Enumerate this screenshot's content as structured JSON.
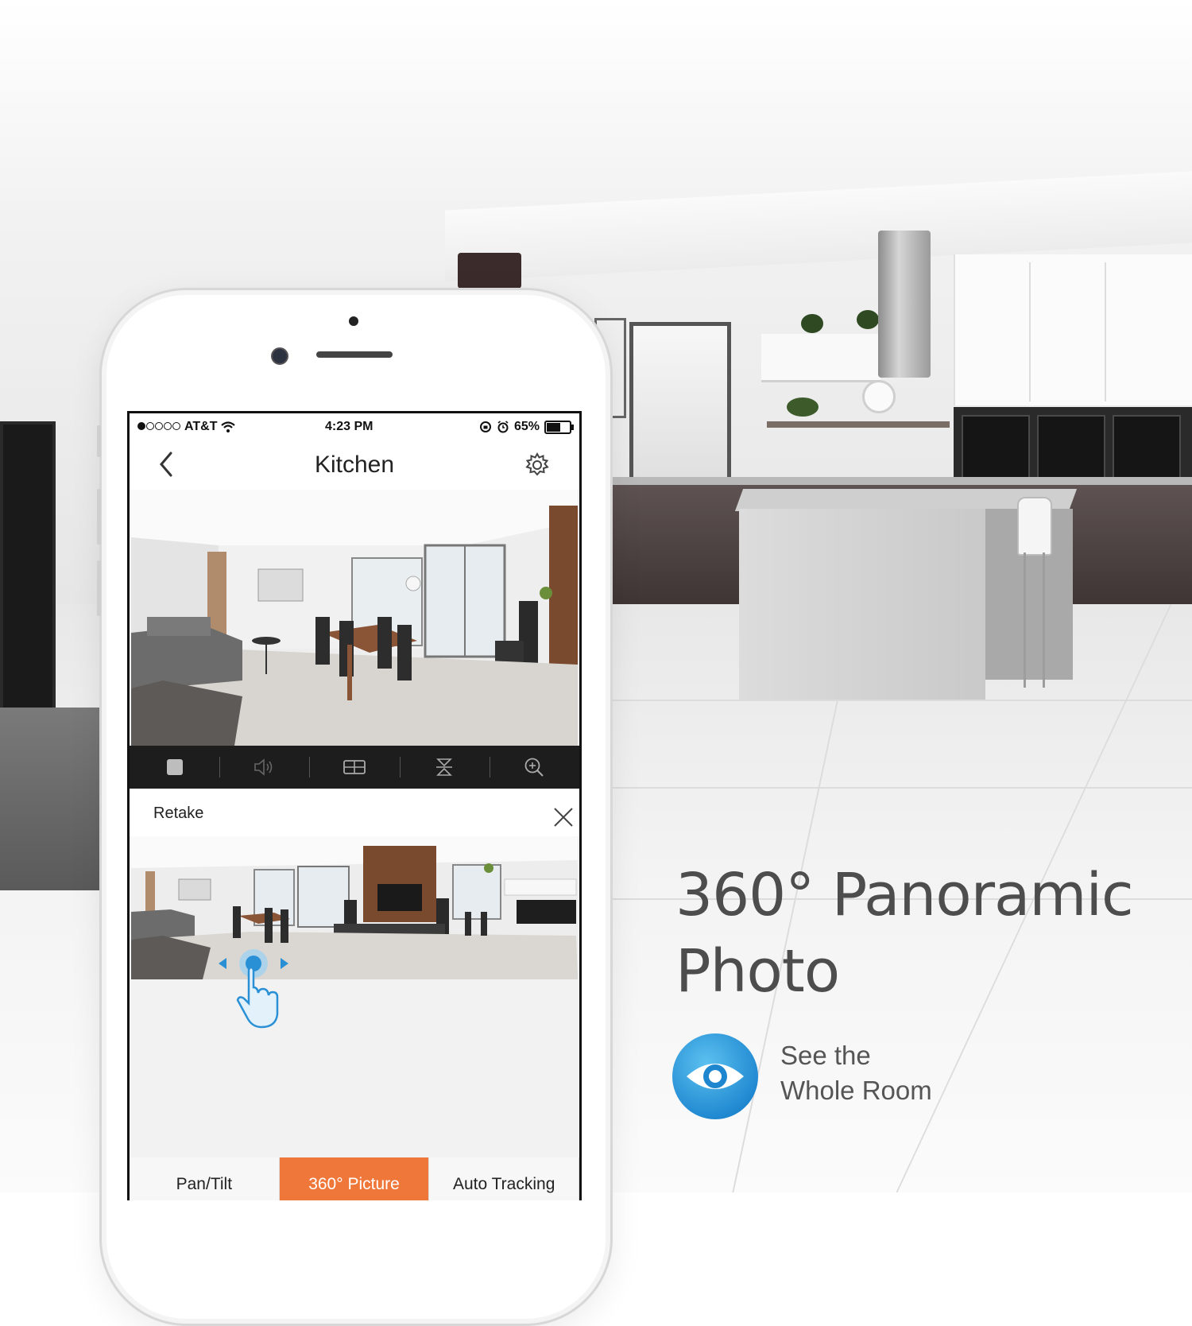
{
  "status_bar": {
    "carrier": "AT&T",
    "time": "4:23 PM",
    "battery": "65%",
    "battery_level": 0.65,
    "signal_bars_filled": 1,
    "signal_bars_total": 5
  },
  "nav": {
    "title": "Kitchen",
    "back_icon": "chevron-left-icon",
    "settings_icon": "gear-icon"
  },
  "toolbar": {
    "items": [
      "stop-icon",
      "speaker-icon",
      "grid-layout-icon",
      "flip-icon",
      "zoom-in-icon"
    ]
  },
  "panorama_panel": {
    "retake_label": "Retake",
    "close_icon": "close-icon"
  },
  "tabs": [
    {
      "label": "Pan/Tilt",
      "active": false
    },
    {
      "label": "360° Picture",
      "active": true
    },
    {
      "label": "Auto Tracking",
      "active": false
    }
  ],
  "marketing": {
    "headline_line1": "360° Panoramic",
    "headline_line2": "Photo",
    "feature_line1": "See the",
    "feature_line2": "Whole Room",
    "feature_icon": "eye-icon"
  },
  "colors": {
    "accent": "#f0773a",
    "badge_blue": "#2a95d8",
    "headline_gray": "#4d4d4d"
  }
}
